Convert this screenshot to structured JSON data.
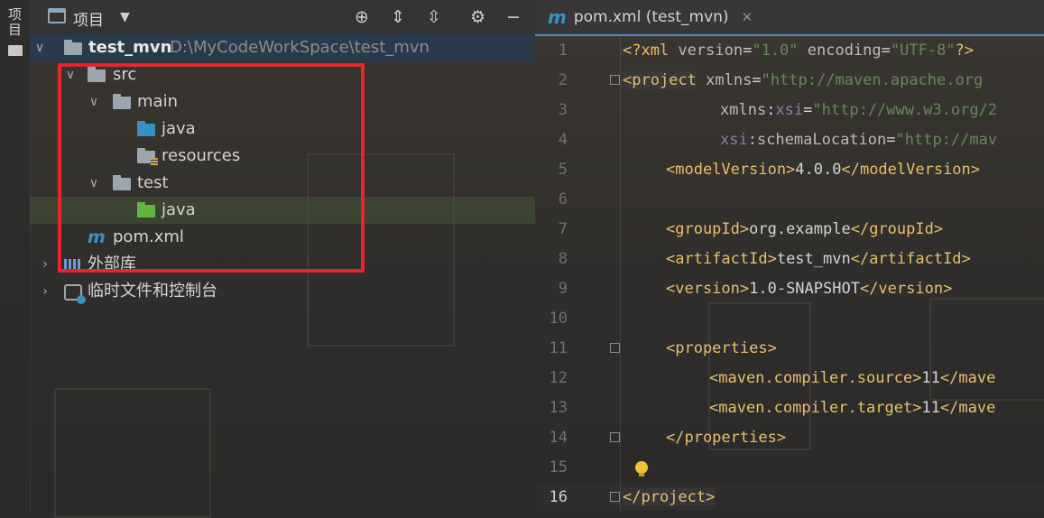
{
  "toolstrip": {
    "label": "项目"
  },
  "project": {
    "title": "项目",
    "tree": [
      {
        "label": "test_mvn",
        "path": "D:\\MyCodeWorkSpace\\test_mvn"
      },
      {
        "label": "src"
      },
      {
        "label": "main"
      },
      {
        "label": "java"
      },
      {
        "label": "resources"
      },
      {
        "label": "test"
      },
      {
        "label": "java"
      },
      {
        "label": "pom.xml"
      },
      {
        "label": "外部库"
      },
      {
        "label": "临时文件和控制台"
      }
    ]
  },
  "editor": {
    "tab_label": "pom.xml (test_mvn)",
    "line_numbers": [
      "1",
      "2",
      "3",
      "4",
      "5",
      "6",
      "7",
      "8",
      "9",
      "10",
      "11",
      "12",
      "13",
      "14",
      "15",
      "16"
    ],
    "code": {
      "l1": {
        "a": "<?xml ",
        "b": "version",
        "c": "=",
        "d": "\"1.0\"",
        "e": " encoding",
        "f": "=",
        "g": "\"UTF-8\"",
        "h": "?>"
      },
      "l2": {
        "a": "<project",
        "b": " xmlns",
        "c": "=",
        "d": "\"http://maven.apache.org"
      },
      "l3": {
        "a": "xmlns",
        "b": ":",
        "c": "xsi",
        "d": "=",
        "e": "\"http://www.w3.org/2"
      },
      "l4": {
        "a": "xsi",
        "b": ":schemaLocation",
        "c": "=",
        "d": "\"http://mav"
      },
      "l5": {
        "a": "<modelVersion>",
        "b": "4.0.0",
        "c": "</modelVersion>"
      },
      "l7": {
        "a": "<groupId>",
        "b": "org.example",
        "c": "</groupId>"
      },
      "l8": {
        "a": "<artifactId>",
        "b": "test_mvn",
        "c": "</artifactId>"
      },
      "l9": {
        "a": "<version>",
        "b": "1.0-SNAPSHOT",
        "c": "</version>"
      },
      "l11": {
        "a": "<properties>"
      },
      "l12": {
        "a": "<maven.compiler.source>",
        "b": "11",
        "c": "</mave"
      },
      "l13": {
        "a": "<maven.compiler.target>",
        "b": "11",
        "c": "</mave"
      },
      "l14": {
        "a": "</properties>"
      },
      "l16": {
        "a": "</project>"
      }
    }
  },
  "colors": {
    "highlight_box": "#e6262c",
    "accent": "#4a88c7"
  }
}
